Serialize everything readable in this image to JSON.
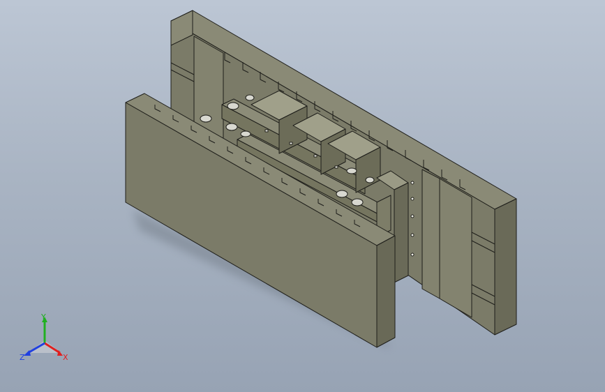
{
  "view": {
    "background_top": "#bcc6d4",
    "background_bottom": "#97a3b4",
    "model_color": "#7b7b68",
    "edge_color": "#1e1e1a"
  },
  "triad": {
    "x_label": "X",
    "y_label": "Y",
    "z_label": "Z",
    "x_color": "#e02020",
    "y_color": "#20b020",
    "z_color": "#2040e0"
  }
}
